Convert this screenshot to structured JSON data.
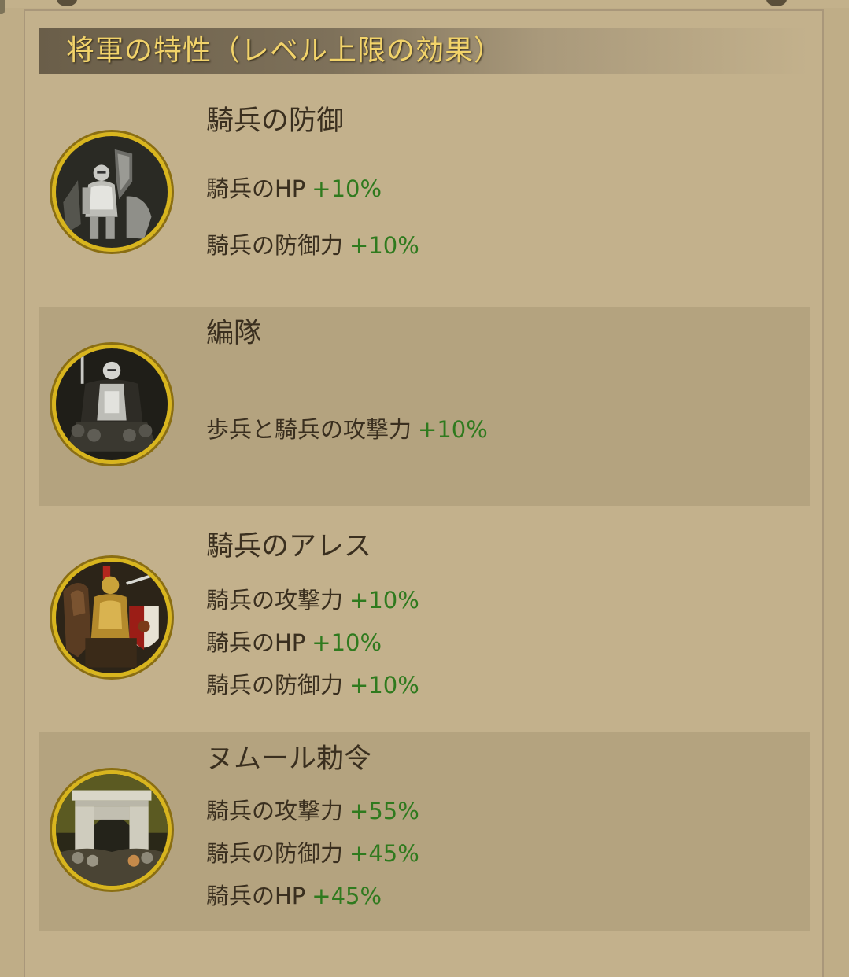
{
  "header": {
    "title": "将軍の特性（レベル上限の効果）"
  },
  "traits": [
    {
      "name": "騎兵の防御",
      "icon": "armored-knight-icon",
      "effects": [
        {
          "label": "騎兵のHP",
          "value": "+10%"
        },
        {
          "label": "騎兵の防御力",
          "value": "+10%"
        }
      ]
    },
    {
      "name": "編隊",
      "icon": "knight-formation-icon",
      "effects": [
        {
          "label": "歩兵と騎兵の攻撃力",
          "value": "+10%"
        }
      ]
    },
    {
      "name": "騎兵のアレス",
      "icon": "mounted-knight-shield-icon",
      "effects": [
        {
          "label": "騎兵の攻撃力",
          "value": "+10%"
        },
        {
          "label": "騎兵のHP",
          "value": "+10%"
        },
        {
          "label": "騎兵の防御力",
          "value": "+10%"
        }
      ]
    },
    {
      "name": "ヌムール勅令",
      "icon": "triumphal-arch-icon",
      "effects": [
        {
          "label": "騎兵の攻撃力",
          "value": "+55%"
        },
        {
          "label": "騎兵の防御力",
          "value": "+45%"
        },
        {
          "label": "騎兵のHP",
          "value": "+45%"
        }
      ]
    }
  ],
  "colors": {
    "background": "#bfad87",
    "shaded_row": "#b4a37f",
    "title_gold": "#f2d36a",
    "text_brown": "#3a2f1f",
    "value_green": "#2f7a1e",
    "ring_gold": "#d8b51e"
  }
}
